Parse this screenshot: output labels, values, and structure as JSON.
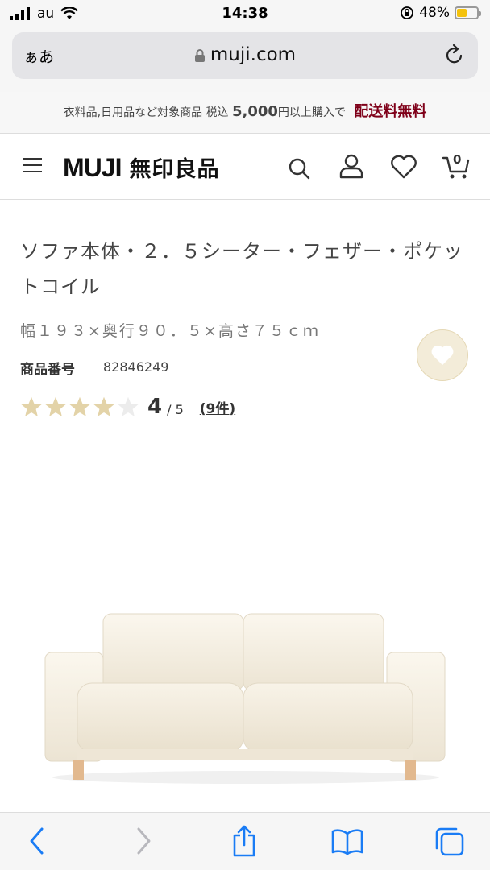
{
  "status_bar": {
    "carrier": "au",
    "time": "14:38",
    "battery_percent": "48%",
    "battery_level": 0.48
  },
  "browser": {
    "text_size_label": "ぁあ",
    "url": "muji.com"
  },
  "promo": {
    "prefix": "衣料品,日用品など対象商品 税込",
    "amount": "5,000",
    "suffix": "円以上購入で",
    "highlight": "配送料無料"
  },
  "header": {
    "logo_latin": "MUJI",
    "logo_japanese": "無印良品",
    "cart_count": "0"
  },
  "product": {
    "title": "ソファ本体・２．５シーター・フェザー・ポケットコイル",
    "dimensions": "幅１９３×奥行９０．５×高さ７５ｃｍ",
    "sku_label": "商品番号",
    "sku": "82846249",
    "rating_value": "4",
    "rating_scale": "/ 5",
    "rating_stars": 4,
    "review_count": "(9件)"
  },
  "colors": {
    "star_filled": "#e3d3a8",
    "star_empty": "#ececec",
    "accent_red": "#7f0019",
    "favorite_bg": "#f3ecd9",
    "link_blue": "#1a7cf5"
  },
  "icons": {
    "header": [
      "hamburger-icon",
      "search-icon",
      "account-icon",
      "heart-icon",
      "cart-icon"
    ],
    "toolbar": [
      "back-icon",
      "forward-icon",
      "share-icon",
      "bookmarks-icon",
      "tabs-icon"
    ]
  }
}
